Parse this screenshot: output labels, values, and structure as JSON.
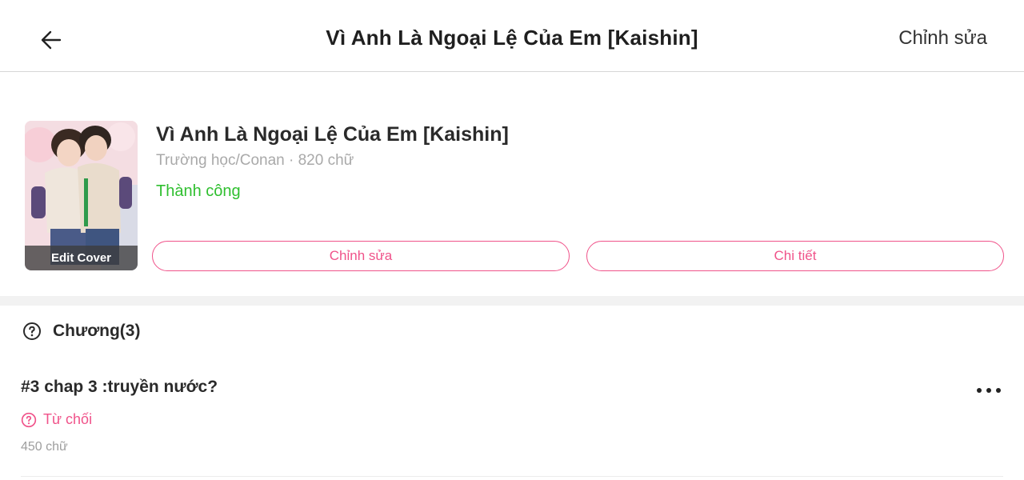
{
  "header": {
    "title": "Vì Anh Là Ngoại Lệ Của Em [Kaishin]",
    "edit_label": "Chỉnh sửa",
    "back_icon": "arrow-left-icon"
  },
  "story": {
    "title": "Vì Anh Là Ngoại Lệ Của Em [Kaishin]",
    "meta": "Trường học/Conan · 820 chữ",
    "status": "Thành công",
    "cover_label": "Edit Cover",
    "edit_button": "Chỉnh sửa",
    "detail_button": "Chi tiết"
  },
  "chapters": {
    "header": "Chương(3)",
    "items": [
      {
        "title": "#3 chap 3 :truyền nước?",
        "status": "Từ chối",
        "words": "450 chữ"
      }
    ]
  },
  "colors": {
    "accent": "#f0538a",
    "success": "#2fbf2f"
  }
}
